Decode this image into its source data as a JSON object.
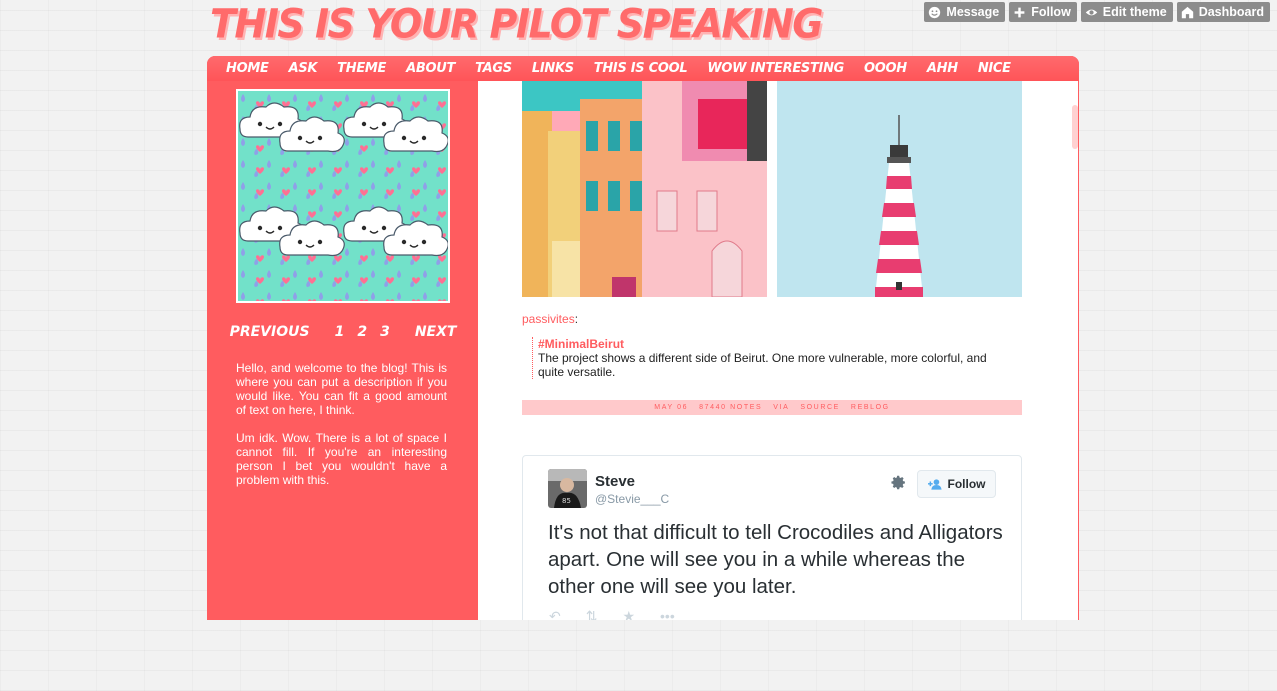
{
  "blog": {
    "title": "This is your pilot speaking",
    "accent_color": "#ff5c5f"
  },
  "controls": [
    {
      "label": "Message",
      "icon": "smile-icon"
    },
    {
      "label": "Follow",
      "icon": "plus-icon"
    },
    {
      "label": "Edit theme",
      "icon": "eye-icon"
    },
    {
      "label": "Dashboard",
      "icon": "house-icon"
    }
  ],
  "nav": [
    "Home",
    "Ask",
    "Theme",
    "About",
    "Tags",
    "Links",
    "This is cool",
    "Wow interesting",
    "Oooh",
    "Ahh",
    "Nice"
  ],
  "pagination": {
    "previous": "Previous",
    "pages": [
      "1",
      "2",
      "3"
    ],
    "next": "Next"
  },
  "description": [
    "Hello, and welcome to the blog! This is where you can put a description if you would like. You can fit a good amount of text on here, I think.",
    "Um idk. Wow. There is a lot of space I cannot fill. If you're an interesting person I bet you wouldn't have a problem with this."
  ],
  "post": {
    "source_user": "passivites",
    "source_colon": ":",
    "tag": "#MinimalBeirut",
    "quote": "The project shows a different side of Beirut. One more vulnerable, more colorful, and quite versatile.",
    "meta": {
      "date": "May 06",
      "notes": "87440 notes",
      "via": "via",
      "source": "source",
      "reblog": "reblog"
    }
  },
  "tweet": {
    "name": "Steve",
    "handle": "@Stevie___C",
    "follow_label": "Follow",
    "text": "It's not that difficult to tell Crocodiles and Alligators apart. One will see you in a while whereas the other one will see you later.",
    "actions": [
      "reply-icon",
      "retweet-icon",
      "favorite-icon",
      "more-icon"
    ]
  }
}
